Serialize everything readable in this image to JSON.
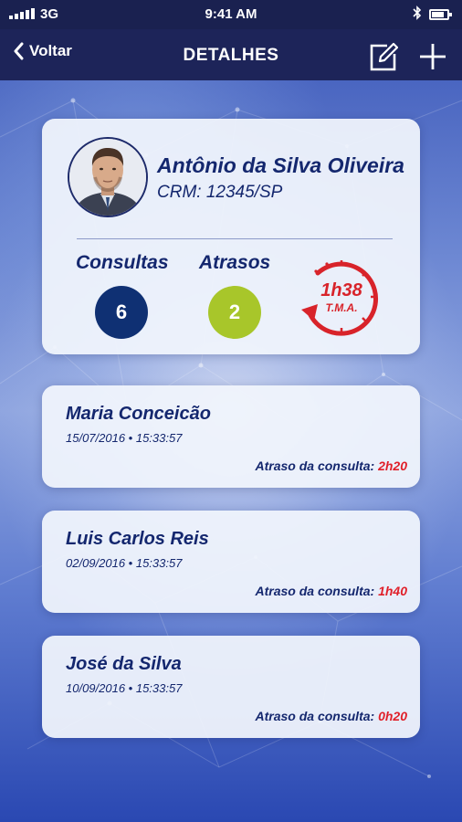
{
  "status_bar": {
    "carrier": "3G",
    "time": "9:41 AM",
    "battery_level": 0.8
  },
  "nav": {
    "back_label": "Voltar",
    "title": "DETALHES",
    "edit_icon": "edit-icon",
    "add_icon": "plus-icon"
  },
  "doctor": {
    "name": "Antônio da Silva Oliveira",
    "crm": "CRM: 12345/SP",
    "stats": {
      "consultas_label": "Consultas",
      "consultas_value": "6",
      "atrasos_label": "Atrasos",
      "atrasos_value": "2",
      "tma_value": "1h38",
      "tma_label": "T.M.A."
    }
  },
  "patients": [
    {
      "name": "Maria Conceicão",
      "datetime": "15/07/2016 • 15:33:57",
      "delay_label": "Atraso da consulta:",
      "delay_value": "2h20"
    },
    {
      "name": "Luis Carlos Reis",
      "datetime": "02/09/2016 • 15:33:57",
      "delay_label": "Atraso da consulta:",
      "delay_value": "1h40"
    },
    {
      "name": "José da Silva",
      "datetime": "10/09/2016 • 15:33:57",
      "delay_label": "Atraso da consulta:",
      "delay_value": "0h20"
    }
  ],
  "colors": {
    "nav_bg": "#1d2459",
    "primary_text": "#14276e",
    "consultas_circle": "#0f3073",
    "atrasos_circle": "#a8c62a",
    "delay_red": "#e0202a"
  }
}
